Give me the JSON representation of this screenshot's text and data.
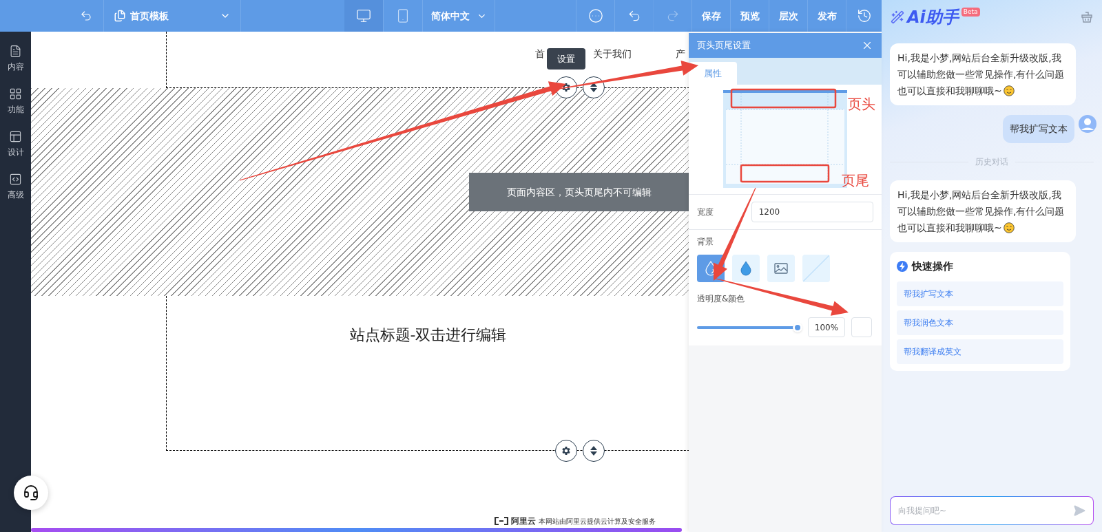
{
  "toolbar": {
    "template": "首页模板",
    "devices": [
      {
        "kind": "desktop",
        "selected": true
      },
      {
        "kind": "mobile",
        "selected": false
      }
    ],
    "language": "简体中文",
    "undo": {
      "disabled": false
    },
    "redo": {
      "disabled": true
    },
    "actions": [
      "保存",
      "预览",
      "层次",
      "发布"
    ]
  },
  "sidebar": [
    "内容",
    "功能",
    "设计",
    "高级"
  ],
  "canvas": {
    "nav": [
      "首",
      "关于我们",
      "产"
    ],
    "tooltip": "设置",
    "notice": "页面内容区，页头页尾内不可编辑",
    "site_title": "站点标题-双击进行编辑",
    "footer_brand": "阿里云",
    "footer_text": "本网站由阿里云提供云计算及安全服务"
  },
  "annotations": {
    "labels": [
      "页头",
      "页尾"
    ]
  },
  "panel": {
    "title": "页头页尾设置",
    "tabs": [
      {
        "label": "属性",
        "selected": true
      }
    ],
    "width_label": "宽度",
    "width_value": "1200",
    "background_label": "背景",
    "background_options": [
      {
        "kind": "transparent",
        "selected": true
      },
      {
        "kind": "color",
        "selected": false
      },
      {
        "kind": "image",
        "selected": false
      },
      {
        "kind": "none",
        "selected": false
      }
    ],
    "opacity_label": "透明度&颜色",
    "opacity": {
      "level": 0.97,
      "reading": "100%"
    }
  },
  "assistant": {
    "title": "Ai助手",
    "badge": "Beta",
    "messages": [
      {
        "kind": "bot",
        "text": "Hi,我是小梦,网站后台全新升级改版,我可以辅助您做一些常见操作,有什么问题也可以直接和我聊聊哦~"
      },
      {
        "kind": "user",
        "text": "帮我扩写文本"
      },
      {
        "kind": "divider",
        "text": "历史对话"
      },
      {
        "kind": "bot",
        "text": "Hi,我是小梦,网站后台全新升级改版,我可以辅助您做一些常见操作,有什么问题也可以直接和我聊聊哦~"
      }
    ],
    "quick_title": "快速操作",
    "quick_items": [
      "帮我扩写文本",
      "帮我润色文本",
      "帮我翻译成英文"
    ],
    "input_placeholder": "向我提问吧~"
  }
}
